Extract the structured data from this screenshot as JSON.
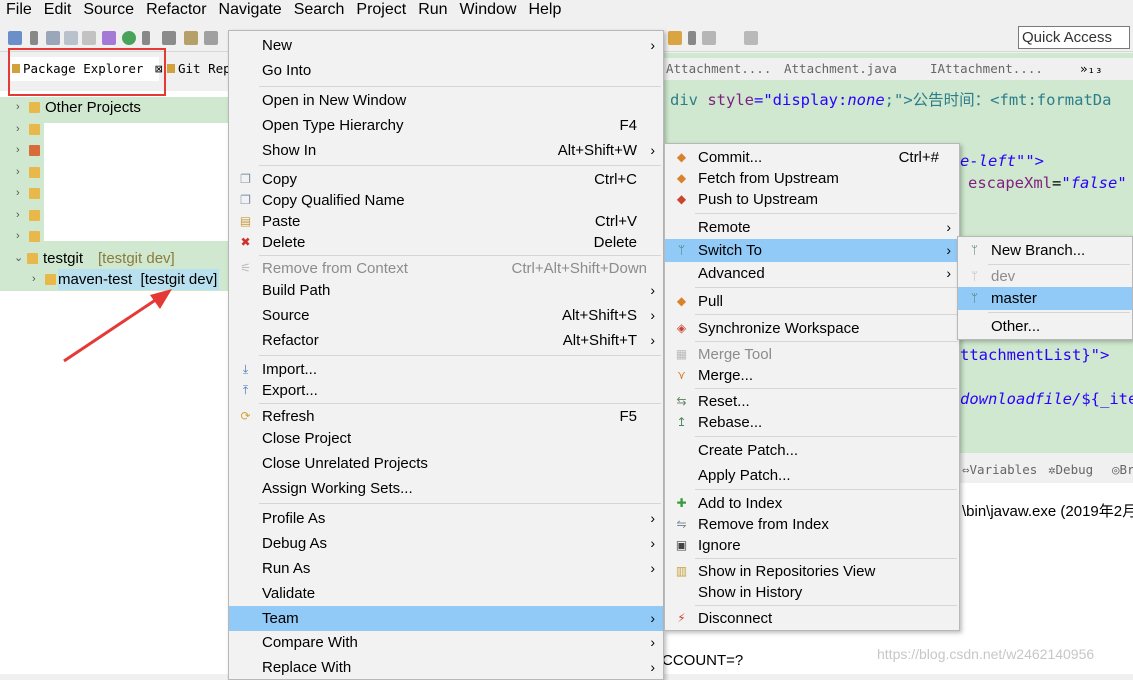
{
  "menubar": [
    "File",
    "Edit",
    "Source",
    "Refactor",
    "Navigate",
    "Search",
    "Project",
    "Run",
    "Window",
    "Help"
  ],
  "toolbar": {
    "quick_access": "Quick Access"
  },
  "left_pane": {
    "tab_package_explorer": "Package Explorer",
    "tab_close": "⊠",
    "tab_git": "Git Rep",
    "tree": {
      "other_projects": "Other Projects",
      "testgit": "testgit",
      "testgit_decoration": "[testgit dev]",
      "maven_test": "maven-test",
      "maven_test_decoration": "[testgit dev]"
    }
  },
  "editor": {
    "tabs": [
      "Attachment....",
      "Attachment.java",
      "IAttachment....",
      "»₁₃"
    ],
    "code": {
      "line1_open": "div ",
      "line1_attr": "style",
      "line1_eq": "=\"display:",
      "line1_val": "none",
      "line1_rest": ";\">公告时间：<fmt:formatDa",
      "line2": "e-left\"\">",
      "line3_attr": "escapeXml",
      "line3_val": "\"false\"",
      "line4": "ttachmentList}\">",
      "line5_val": "downloadfile/",
      "line5_rest": "${_ite"
    }
  },
  "console": {
    "tabs": [
      "Variables",
      "Debug",
      "Br"
    ],
    "line1": "\\bin\\javaw.exe (2019年2月",
    "line2": "CCOUNT=?"
  },
  "context_menu": {
    "items": [
      {
        "label": "New",
        "submenu": true
      },
      {
        "label": "Go Into"
      },
      {
        "label": "Open in New Window"
      },
      {
        "label": "Open Type Hierarchy",
        "accel": "F4"
      },
      {
        "label": "Show In",
        "accel": "Alt+Shift+W",
        "submenu": true
      },
      {
        "label": "Copy",
        "accel": "Ctrl+C"
      },
      {
        "label": "Copy Qualified Name"
      },
      {
        "label": "Paste",
        "accel": "Ctrl+V"
      },
      {
        "label": "Delete",
        "accel": "Delete"
      },
      {
        "label": "Remove from Context",
        "accel": "Ctrl+Alt+Shift+Down",
        "disabled": true
      },
      {
        "label": "Build Path",
        "submenu": true
      },
      {
        "label": "Source",
        "accel": "Alt+Shift+S",
        "submenu": true
      },
      {
        "label": "Refactor",
        "accel": "Alt+Shift+T",
        "submenu": true
      },
      {
        "label": "Import..."
      },
      {
        "label": "Export..."
      },
      {
        "label": "Refresh",
        "accel": "F5"
      },
      {
        "label": "Close Project"
      },
      {
        "label": "Close Unrelated Projects"
      },
      {
        "label": "Assign Working Sets..."
      },
      {
        "label": "Profile As",
        "submenu": true
      },
      {
        "label": "Debug As",
        "submenu": true
      },
      {
        "label": "Run As",
        "submenu": true
      },
      {
        "label": "Validate"
      },
      {
        "label": "Team",
        "submenu": true,
        "highlighted": true
      },
      {
        "label": "Compare With",
        "submenu": true
      },
      {
        "label": "Replace With",
        "submenu": true
      }
    ]
  },
  "team_menu": {
    "items": [
      {
        "label": "Commit...",
        "accel": "Ctrl+#"
      },
      {
        "label": "Fetch from Upstream"
      },
      {
        "label": "Push to Upstream"
      },
      {
        "label": "Remote",
        "submenu": true
      },
      {
        "label": "Switch To",
        "submenu": true,
        "highlighted": true
      },
      {
        "label": "Advanced",
        "submenu": true
      },
      {
        "label": "Pull"
      },
      {
        "label": "Synchronize Workspace"
      },
      {
        "label": "Merge Tool",
        "disabled": true
      },
      {
        "label": "Merge..."
      },
      {
        "label": "Reset..."
      },
      {
        "label": "Rebase..."
      },
      {
        "label": "Create Patch..."
      },
      {
        "label": "Apply Patch..."
      },
      {
        "label": "Add to Index"
      },
      {
        "label": "Remove from Index"
      },
      {
        "label": "Ignore"
      },
      {
        "label": "Show in Repositories View"
      },
      {
        "label": "Show in History"
      },
      {
        "label": "Disconnect"
      }
    ]
  },
  "switch_menu": {
    "items": [
      {
        "label": "New Branch..."
      },
      {
        "label": "dev",
        "disabled": true
      },
      {
        "label": "master",
        "highlighted": true
      },
      {
        "label": "Other..."
      }
    ]
  },
  "colors": {
    "menu_highlight": "#91c9f7",
    "tree_background": "#cfe8cf",
    "annotation_red": "#e53935"
  },
  "watermark": "https://blog.csdn.net/w2462140956"
}
